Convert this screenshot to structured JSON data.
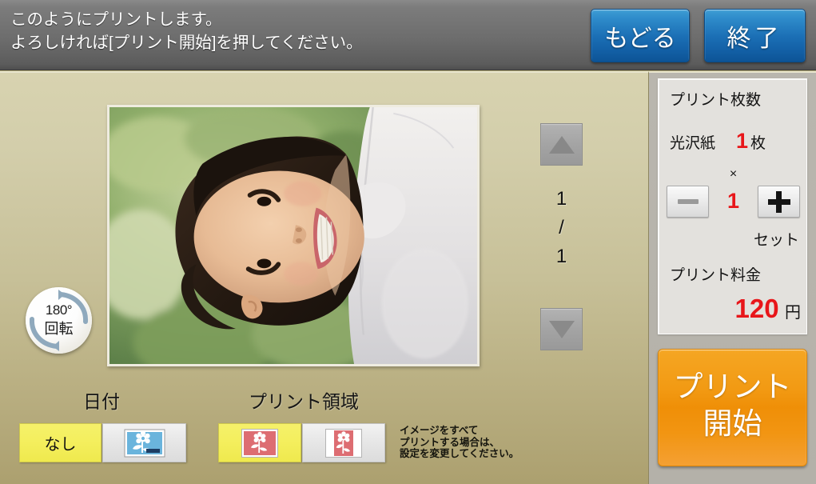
{
  "header": {
    "message_line1": "このようにプリントします。",
    "message_line2": "よろしければ[プリント開始]を押してください。",
    "back_label": "もどる",
    "exit_label": "終了"
  },
  "preview": {
    "rotate_degrees": "180°",
    "rotate_label": "回転",
    "page_current": "1",
    "page_separator": "/",
    "page_total": "1"
  },
  "options": {
    "date_label": "日付",
    "date_none_label": "なし",
    "date_on_label": "",
    "area_label": "プリント領域",
    "hint_line1": "イメージをすべて",
    "hint_line2": "プリントする場合は、",
    "hint_line3": "設定を変更してください。"
  },
  "sidebar": {
    "count_title": "プリント枚数",
    "paper_type": "光沢紙",
    "paper_count": "1",
    "paper_unit": "枚",
    "times_symbol": "×",
    "set_count": "1",
    "set_unit": "セット",
    "fee_title": "プリント料金",
    "fee_value": "120",
    "fee_unit": "円",
    "print_start_label": "プリント\n開始"
  },
  "colors": {
    "accent_red": "#e8161a",
    "accent_orange": "#ef8f07",
    "accent_blue": "#1b6fb5",
    "selected_yellow": "#f4ef5e",
    "background_khaki": "#c7c098",
    "header_gray": "#6d6d6d"
  }
}
